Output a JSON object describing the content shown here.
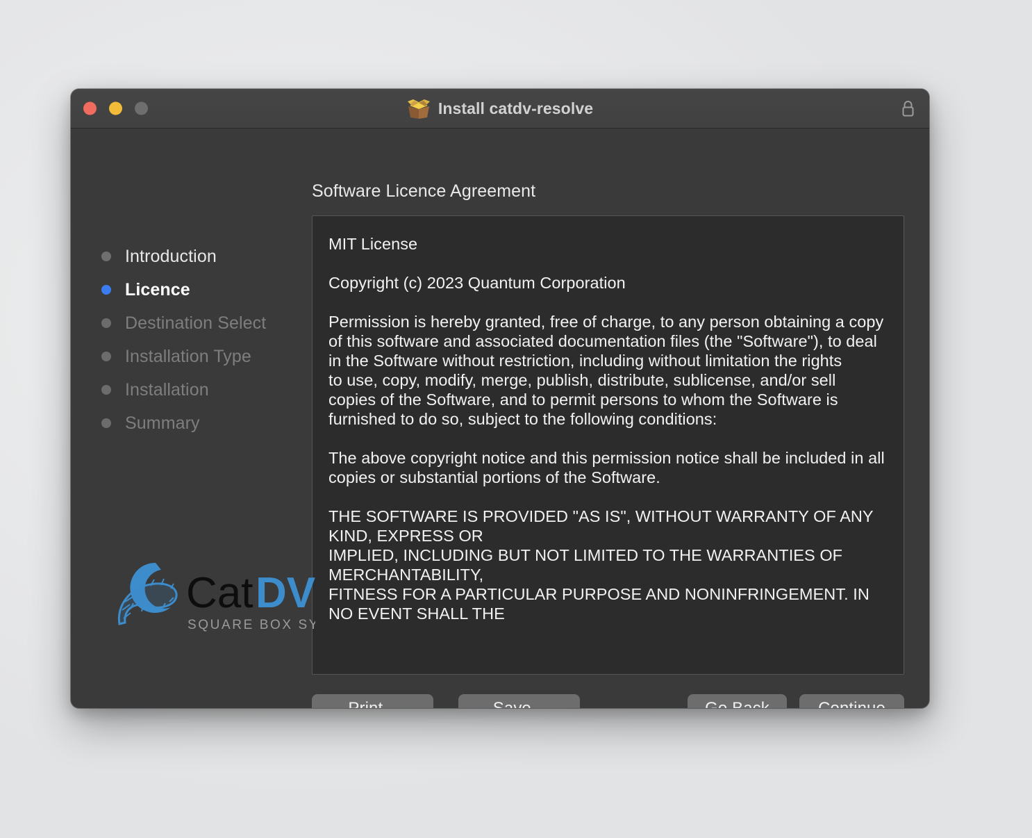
{
  "window": {
    "title": "Install catdv-resolve",
    "package_icon": "package-box-icon",
    "lock_icon": "lock-icon",
    "traffic_lights": [
      {
        "name": "close-button",
        "color": "#ef6c5e"
      },
      {
        "name": "minimize-button",
        "color": "#f2bb38"
      },
      {
        "name": "zoom-button",
        "color": "#6e6e6e"
      }
    ]
  },
  "sidebar": {
    "steps": [
      {
        "label": "Introduction",
        "state": "done"
      },
      {
        "label": "Licence",
        "state": "active"
      },
      {
        "label": "Destination Select",
        "state": "pending"
      },
      {
        "label": "Installation Type",
        "state": "pending"
      },
      {
        "label": "Installation",
        "state": "pending"
      },
      {
        "label": "Summary",
        "state": "pending"
      }
    ],
    "logo": {
      "name": "catdv-logo",
      "word_dark": "Cat",
      "word_accent": "DV",
      "tagline": "SQUARE BOX SYSTEMS",
      "accent_color": "#3d8ccb",
      "dark_color": "#0d0d0d",
      "tagline_color": "#9a9a9a"
    }
  },
  "main": {
    "heading": "Software Licence Agreement",
    "licence_text": "MIT License\n\nCopyright (c) 2023 Quantum Corporation\n\nPermission is hereby granted, free of charge, to any person obtaining a copy\nof this software and associated documentation files (the \"Software\"), to deal\nin the Software without restriction, including without limitation the rights\nto use, copy, modify, merge, publish, distribute, sublicense, and/or sell\ncopies of the Software, and to permit persons to whom the Software is\nfurnished to do so, subject to the following conditions:\n\nThe above copyright notice and this permission notice shall be included in all\ncopies or substantial portions of the Software.\n\nTHE SOFTWARE IS PROVIDED \"AS IS\", WITHOUT WARRANTY OF ANY KIND, EXPRESS OR\nIMPLIED, INCLUDING BUT NOT LIMITED TO THE WARRANTIES OF MERCHANTABILITY,\nFITNESS FOR A PARTICULAR PURPOSE AND NONINFRINGEMENT. IN NO EVENT SHALL THE"
  },
  "buttons": {
    "print": "Print...",
    "save": "Save...",
    "go_back": "Go Back",
    "continue": "Continue"
  },
  "colors": {
    "desktop_background": "#e9eaeb",
    "window_body": "#3a3a3a",
    "titlebar": "#434343",
    "licence_panel": "#2c2c2c",
    "button": "#6d6d6d",
    "active_step_dot": "#3b7df0",
    "pending_step_text": "#7e7e7e"
  }
}
